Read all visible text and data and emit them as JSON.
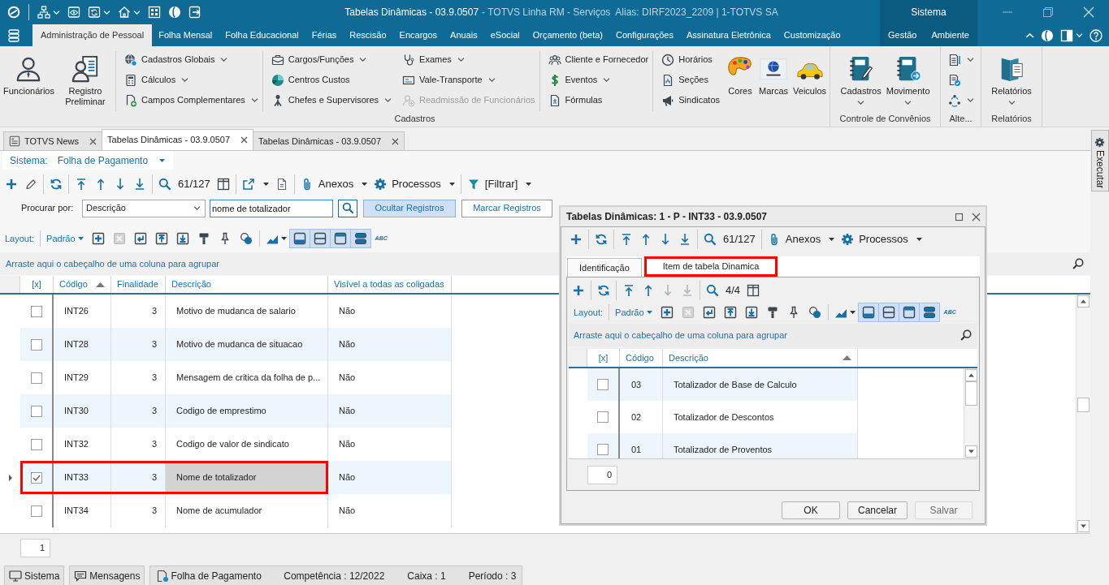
{
  "title_bar": {
    "quick_access": [
      {
        "dropdown": true
      },
      {
        "dropdown": false
      },
      {
        "dropdown": true
      },
      {
        "dropdown": true
      },
      {
        "dropdown": false
      },
      {
        "dropdown": false
      },
      {
        "dropdown": false
      }
    ],
    "title": "Tabelas Dinâmicas - 03.9.0507",
    "subtitle": "- TOTVS Linha RM - Serviços  Alias: DIRF2023_2209 | 1-TOTVS SA"
  },
  "ribbon_tabs": [
    {
      "label": "Administração de Pessoal",
      "selected": true
    },
    {
      "label": "Folha Mensal",
      "selected": false
    },
    {
      "label": "Folha Educacional",
      "selected": false
    },
    {
      "label": "Férias",
      "selected": false
    },
    {
      "label": "Rescisão",
      "selected": false
    },
    {
      "label": "Encargos",
      "selected": false
    },
    {
      "label": "Anuais",
      "selected": false
    },
    {
      "label": "eSocial",
      "selected": false
    },
    {
      "label": "Orçamento (beta)",
      "selected": false
    },
    {
      "label": "Configurações",
      "selected": false
    },
    {
      "label": "Assinatura Eletrônica",
      "selected": false
    },
    {
      "label": "Customização",
      "selected": false
    }
  ],
  "context_tabs": {
    "label": "Sistema",
    "tabs": [
      {
        "label": "Gestão",
        "selected": false
      },
      {
        "label": "Ambiente",
        "selected": false
      }
    ]
  },
  "ribbon_groups": [
    {
      "label": "Cadastros",
      "sections": [
        {
          "kind": "large",
          "items": [
            {
              "label": "Funcionários",
              "dropdown": false,
              "disabled": false
            },
            {
              "label": "Registro Preliminar",
              "dropdown": false,
              "disabled": false
            }
          ]
        },
        {
          "kind": "stack",
          "items": [
            {
              "label": "Cadastros Globais",
              "dropdown": true,
              "disabled": false
            },
            {
              "label": "Cálculos",
              "dropdown": true,
              "disabled": false
            },
            {
              "label": "Campos Complementares",
              "dropdown": true,
              "disabled": false
            }
          ]
        },
        {
          "kind": "stack",
          "items": [
            {
              "label": "Cargos/Funções",
              "dropdown": true,
              "disabled": false
            },
            {
              "label": "Centros Custos",
              "dropdown": false,
              "disabled": false
            },
            {
              "label": "Chefes e Supervisores",
              "dropdown": true,
              "disabled": false
            }
          ]
        },
        {
          "kind": "stack",
          "items": [
            {
              "label": "Exames",
              "dropdown": true,
              "disabled": false
            },
            {
              "label": "Vale-Transporte",
              "dropdown": true,
              "disabled": false
            },
            {
              "label": "Readmissão de Funcionários",
              "dropdown": false,
              "disabled": true
            }
          ]
        },
        {
          "kind": "stack",
          "items": [
            {
              "label": "Cliente e Fornecedor",
              "dropdown": false,
              "disabled": false
            },
            {
              "label": "Eventos",
              "dropdown": true,
              "disabled": false
            },
            {
              "label": "Fórmulas",
              "dropdown": false,
              "disabled": false
            }
          ]
        },
        {
          "kind": "stack",
          "items": [
            {
              "label": "Horários",
              "dropdown": false,
              "disabled": false
            },
            {
              "label": "Seções",
              "dropdown": false,
              "disabled": false
            },
            {
              "label": "Sindicatos",
              "dropdown": false,
              "disabled": false
            }
          ]
        },
        {
          "kind": "large",
          "items": [
            {
              "label": "Cores",
              "dropdown": false,
              "disabled": false
            },
            {
              "label": "Marcas",
              "dropdown": false,
              "disabled": false
            },
            {
              "label": "Veiculos",
              "dropdown": false,
              "disabled": false
            }
          ]
        }
      ]
    },
    {
      "label": "Controle de Convênios",
      "sections": [
        {
          "kind": "large",
          "items": [
            {
              "label": "Cadastros",
              "dropdown": true,
              "disabled": false
            },
            {
              "label": "Movimento",
              "dropdown": true,
              "disabled": false
            }
          ]
        }
      ]
    },
    {
      "label": "Alte...",
      "sections": [
        {
          "kind": "stack",
          "items": [
            {
              "dropdown": true,
              "disabled": false
            },
            {
              "dropdown": false,
              "disabled": false
            },
            {
              "dropdown": true,
              "disabled": false
            }
          ]
        }
      ]
    },
    {
      "label": "Relatórios",
      "sections": [
        {
          "kind": "large",
          "items": [
            {
              "label": "Relatórios",
              "dropdown": true,
              "disabled": false
            }
          ]
        }
      ]
    }
  ],
  "document_tabs": [
    {
      "label": "TOTVS News",
      "selected": false
    },
    {
      "label": "Tabelas Dinâmicas - 03.9.0507",
      "selected": true
    },
    {
      "label": "Tabelas Dinâmicas - 03.9.0507",
      "selected": false
    }
  ],
  "system_selector": {
    "label": "Sistema:",
    "value": "Folha de Pagamento"
  },
  "toolbar": [
    [
      {
        "kind": "add"
      },
      {
        "kind": "edit"
      }
    ],
    [
      {
        "kind": "refresh"
      }
    ],
    [
      {
        "kind": "first"
      },
      {
        "kind": "previous"
      },
      {
        "kind": "next"
      },
      {
        "kind": "last"
      }
    ],
    [
      {
        "kind": "search",
        "label": "61/127"
      },
      {
        "kind": "columns"
      }
    ],
    [
      {
        "kind": "export"
      },
      {
        "kind": "report"
      }
    ],
    [
      {
        "kind": "attachments",
        "label": "Anexos"
      },
      {
        "kind": "processes",
        "label": "Processos"
      }
    ],
    [
      {
        "kind": "filter",
        "label": "[Filtrar]"
      }
    ]
  ],
  "search_bar": {
    "label": "Procurar por:",
    "field": "Descrição",
    "query": "nome de totalizador",
    "buttons": [
      {
        "label": "Ocultar Registros",
        "on": true
      },
      {
        "label": "Marcar Registros",
        "on": false
      }
    ]
  },
  "layout_bar": {
    "label": "Layout:",
    "preset": "Padrão",
    "tools": [
      [
        {
          "kind": "new",
          "disabled": false,
          "on": false
        },
        {
          "kind": "delete",
          "disabled": true,
          "on": false
        },
        {
          "kind": "apply",
          "disabled": false,
          "on": false
        },
        {
          "kind": "upload",
          "disabled": false,
          "on": false
        },
        {
          "kind": "download",
          "disabled": false,
          "on": false
        },
        {
          "kind": "paint",
          "disabled": false,
          "on": false
        },
        {
          "kind": "pin",
          "disabled": false,
          "on": false
        },
        {
          "kind": "shapes",
          "disabled": false,
          "on": false
        }
      ],
      [
        {
          "kind": "chart",
          "disabled": false,
          "on": false
        },
        {
          "kind": "view_bottom",
          "disabled": false,
          "on": true
        },
        {
          "kind": "view_middle",
          "disabled": false,
          "on": true
        },
        {
          "kind": "view_top",
          "disabled": false,
          "on": true
        },
        {
          "kind": "view_split",
          "disabled": false,
          "on": true
        },
        {
          "kind": "spell",
          "label": "ABC",
          "disabled": false
        }
      ]
    ]
  },
  "group_hint": "Arraste aqui o cabeçalho de uma coluna para agrupar",
  "grid": {
    "checkbox_header": "[x]",
    "columns": [
      {
        "label": "Código",
        "sorted": true,
        "focused": false
      },
      {
        "label": "Finalidade",
        "sorted": false,
        "focused": false
      },
      {
        "label": "Descrição",
        "sorted": false,
        "focused": true
      },
      {
        "label": "Visível a todas as coligadas",
        "sorted": false,
        "focused": false
      }
    ],
    "rows": [
      {
        "checked": false,
        "selected": false,
        "highlighted": false,
        "cells": [
          "INT26",
          "3",
          "Motivo de mudanca de salario",
          "Não"
        ]
      },
      {
        "checked": false,
        "selected": false,
        "highlighted": false,
        "cells": [
          "INT28",
          "3",
          "Motivo de mudanca de situacao",
          "Não"
        ]
      },
      {
        "checked": false,
        "selected": false,
        "highlighted": false,
        "cells": [
          "INT29",
          "3",
          "Mensagem de critica da folha de p...",
          "Não"
        ]
      },
      {
        "checked": false,
        "selected": false,
        "highlighted": false,
        "cells": [
          "INT30",
          "3",
          "Codigo de emprestimo",
          "Não"
        ]
      },
      {
        "checked": false,
        "selected": false,
        "highlighted": false,
        "cells": [
          "INT32",
          "3",
          "Codigo de valor de sindicato",
          "Não"
        ]
      },
      {
        "checked": true,
        "selected": true,
        "highlighted": true,
        "cells": [
          "INT33",
          "3",
          "Nome de totalizador",
          "Não"
        ]
      },
      {
        "checked": false,
        "selected": false,
        "highlighted": false,
        "cells": [
          "INT34",
          "3",
          "Nome de acumulador",
          "Não"
        ]
      }
    ],
    "record_count": "1"
  },
  "dialog": {
    "title": "Tabelas Dinâmicas: 1 - P - INT33 - 03.9.0507",
    "toolbar": [
      [
        {
          "kind": "add"
        }
      ],
      [
        {
          "kind": "refresh"
        }
      ],
      [
        {
          "kind": "first"
        },
        {
          "kind": "previous"
        },
        {
          "kind": "next"
        },
        {
          "kind": "last"
        }
      ],
      [
        {
          "kind": "search",
          "label": "61/127"
        }
      ],
      [
        {
          "kind": "attachments",
          "label": "Anexos"
        },
        {
          "kind": "processes",
          "label": "Processos"
        }
      ]
    ],
    "tabs": [
      {
        "label": "Identificação",
        "selected": false,
        "highlighted": false
      },
      {
        "label": "Item de tabela Dinamica",
        "selected": true,
        "highlighted": true
      }
    ],
    "tab_content": {
      "toolbar": [
        [
          {
            "kind": "add",
            "disabled": false
          }
        ],
        [
          {
            "kind": "refresh",
            "disabled": false
          }
        ],
        [
          {
            "kind": "first",
            "disabled": false
          },
          {
            "kind": "previous",
            "disabled": false
          },
          {
            "kind": "next",
            "disabled": true
          },
          {
            "kind": "last",
            "disabled": true
          }
        ],
        [
          {
            "kind": "search",
            "label": "4/4",
            "disabled": false
          },
          {
            "kind": "columns",
            "disabled": false
          }
        ]
      ],
      "layout_bar": {
        "label": "Layout:",
        "preset": "Padrão",
        "tools": [
          [
            {
              "kind": "new",
              "disabled": false,
              "on": false
            },
            {
              "kind": "delete",
              "disabled": true,
              "on": false
            },
            {
              "kind": "apply",
              "disabled": false,
              "on": false
            },
            {
              "kind": "upload",
              "disabled": false,
              "on": false
            },
            {
              "kind": "download",
              "disabled": false,
              "on": false
            },
            {
              "kind": "paint",
              "disabled": false,
              "on": false
            },
            {
              "kind": "pin",
              "disabled": false,
              "on": false
            },
            {
              "kind": "shapes",
              "disabled": false,
              "on": false
            }
          ],
          [
            {
              "kind": "chart",
              "disabled": false,
              "on": false
            },
            {
              "kind": "view_bottom",
              "disabled": false,
              "on": true
            },
            {
              "kind": "view_middle",
              "disabled": false,
              "on": true
            },
            {
              "kind": "view_top",
              "disabled": false,
              "on": true
            },
            {
              "kind": "view_split",
              "disabled": false,
              "on": true
            },
            {
              "kind": "spell",
              "label": "ABC",
              "disabled": false
            }
          ]
        ]
      },
      "group_hint": "Arraste aqui o cabeçalho de uma coluna para agrupar",
      "grid": {
        "checkbox_header": "[x]",
        "columns": [
          {
            "label": "Código",
            "sorted": false
          },
          {
            "label": "Descrição",
            "sorted": true
          }
        ],
        "rows": [
          {
            "checked": false,
            "selected": false,
            "cells": [
              "03",
              "Totalizador de Base de Calculo"
            ]
          },
          {
            "checked": false,
            "selected": false,
            "cells": [
              "02",
              "Totalizador de Descontos"
            ]
          },
          {
            "checked": false,
            "selected": false,
            "cells": [
              "01",
              "Totalizador de Proventos"
            ]
          }
        ],
        "record_count": "0"
      }
    },
    "buttons": [
      {
        "label": "OK",
        "disabled": false
      },
      {
        "label": "Cancelar",
        "disabled": false
      },
      {
        "label": "Salvar",
        "disabled": true
      }
    ]
  },
  "side_panel": {
    "label": "Executar"
  },
  "status_bar": {
    "buttons": [
      {
        "label": "Sistema"
      },
      {
        "label": "Mensagens"
      }
    ],
    "system": "Folha de Pagamento",
    "fields": [
      "Competência : 12/2022",
      "Caixa : 1",
      "Período : 3"
    ]
  }
}
